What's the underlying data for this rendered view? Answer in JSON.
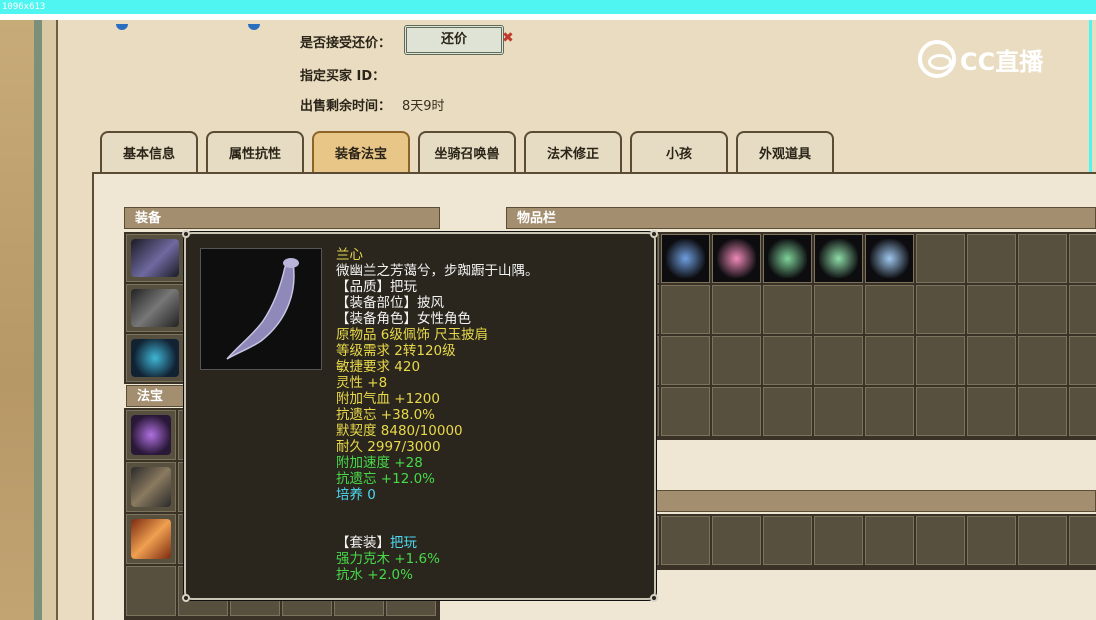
{
  "screen": {
    "size_label": "1096x613"
  },
  "listing": {
    "accept_counter_label": "是否接受还价：",
    "counter_button": "还价",
    "close_mark": "✖",
    "buyer_label": "指定买家 ID：",
    "remaining_label": "出售剩余时间：",
    "remaining_value": "8天9时"
  },
  "logo": {
    "text": "CC直播"
  },
  "tabs": [
    {
      "label": "基本信息",
      "active": false
    },
    {
      "label": "属性抗性",
      "active": false
    },
    {
      "label": "装备法宝",
      "active": true
    },
    {
      "label": "坐骑召唤兽",
      "active": false
    },
    {
      "label": "法术修正",
      "active": false
    },
    {
      "label": "小孩",
      "active": false
    },
    {
      "label": "外观道具",
      "active": false
    }
  ],
  "sections": {
    "equipment": "装备",
    "treasure": "法宝",
    "inventory": "物品栏"
  },
  "tooltip": {
    "name": "兰心",
    "description": "微幽兰之芳蔼兮，步踟蹰于山隅。",
    "quality": "【品质】把玩",
    "slot": "【装备部位】披风",
    "role": "【装备角色】女性角色",
    "origin": "原物品 6级佩饰 尺玉披肩",
    "level_req": "等级需求 2转120级",
    "agility_req": "敏捷要求 420",
    "spirit": "灵性 +8",
    "hp_bonus": "附加气血 +1200",
    "anti_forget": "抗遗忘 +38.0%",
    "tacit": "默契度 8480/10000",
    "durability": "耐久 2997/3000",
    "speed_bonus": "附加速度 +28",
    "anti_forget2": "抗遗忘 +12.0%",
    "cultivate": "培养 0",
    "set_label": "【套装】",
    "set_name": "把玩",
    "set_bonus1": "强力克木 +1.6%",
    "set_bonus2": "抗水 +2.0%"
  },
  "colors": {
    "tooltip_bg": "#2a261d",
    "yellow_text": "#e8d84a",
    "green_text": "#47d94a",
    "cyan_text": "#4fd8f0",
    "active_tab": "#e8c688"
  },
  "inventory_items": [
    {
      "icon": "blue-crystal-icon",
      "color": "#6f9fe0"
    },
    {
      "icon": "pink-heart-icon",
      "color": "#f08ab8"
    },
    {
      "icon": "green-gem-icon",
      "color": "#7fd39a"
    },
    {
      "icon": "green-gem-icon",
      "color": "#8fdca8"
    },
    {
      "icon": "ice-cube-icon",
      "color": "#9fc7ef"
    }
  ]
}
